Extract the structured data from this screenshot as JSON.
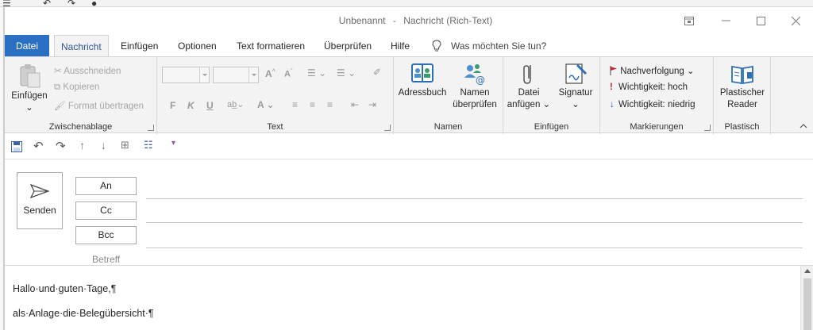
{
  "window": {
    "title_doc": "Unbenannt",
    "title_sep": "-",
    "title_kind": "Nachricht (Rich-Text)"
  },
  "tabs": [
    {
      "label": "Datei"
    },
    {
      "label": "Nachricht"
    },
    {
      "label": "Einfügen"
    },
    {
      "label": "Optionen"
    },
    {
      "label": "Text formatieren"
    },
    {
      "label": "Überprüfen"
    },
    {
      "label": "Hilfe"
    }
  ],
  "tellme": "Was möchten Sie tun?",
  "ribbon": {
    "clipboard": {
      "paste": "Einfügen",
      "cut": "Ausschneiden",
      "copy": "Kopieren",
      "format_painter": "Format übertragen",
      "label": "Zwischenablage"
    },
    "text": {
      "bold": "F",
      "italic": "K",
      "underline": "U",
      "label": "Text"
    },
    "names": {
      "addressbook": "Adressbuch",
      "check_names_1": "Namen",
      "check_names_2": "überprüfen",
      "label": "Namen"
    },
    "insert": {
      "attach_1": "Datei",
      "attach_2": "anfügen",
      "signature": "Signatur",
      "label": "Einfügen"
    },
    "tags": {
      "followup": "Nachverfolgung",
      "high": "Wichtigkeit: hoch",
      "low": "Wichtigkeit: niedrig",
      "label": "Markierungen"
    },
    "immersive": {
      "reader_1": "Plastischer",
      "reader_2": "Reader",
      "label": "Plastisch"
    }
  },
  "compose": {
    "send": "Senden",
    "to": "An",
    "cc": "Cc",
    "bcc": "Bcc",
    "subject": "Betreff"
  },
  "body": {
    "line1": "Hallo·und·guten·Tage,¶",
    "line2": "als·Anlage·die·Belegübersicht·¶"
  },
  "colors": {
    "file_tab": "#2b6fc2",
    "active_tab_text": "#2b579a",
    "flag_red": "#c0262d",
    "arrow_blue": "#1f5fb8"
  }
}
